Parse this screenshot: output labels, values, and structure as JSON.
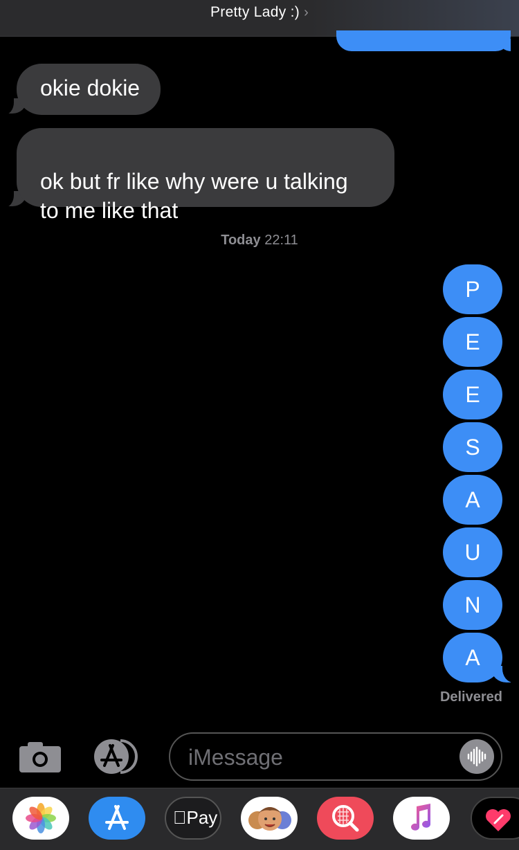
{
  "header": {
    "title": "Pretty Lady :)"
  },
  "messages_in": [
    {
      "text": "okie dokie"
    },
    {
      "text": "ok but fr like why were u talking\nto me like that"
    }
  ],
  "timestamp": {
    "day": "Today",
    "time": "22:11"
  },
  "messages_out": [
    {
      "text": "P"
    },
    {
      "text": "E"
    },
    {
      "text": "E"
    },
    {
      "text": "S"
    },
    {
      "text": "A"
    },
    {
      "text": "U"
    },
    {
      "text": "N"
    },
    {
      "text": "A"
    }
  ],
  "status": {
    "delivered": "Delivered"
  },
  "input": {
    "placeholder": "iMessage"
  },
  "dock": {
    "apple_pay_label": "Pay",
    "apps": [
      "photos-icon",
      "app-store-icon",
      "apple-pay-icon",
      "memoji-icon",
      "web-images-icon",
      "music-icon",
      "heart-app-icon"
    ]
  },
  "colors": {
    "outgoing": "#3d8ef6",
    "incoming": "#3b3b3d",
    "background": "#000000"
  }
}
